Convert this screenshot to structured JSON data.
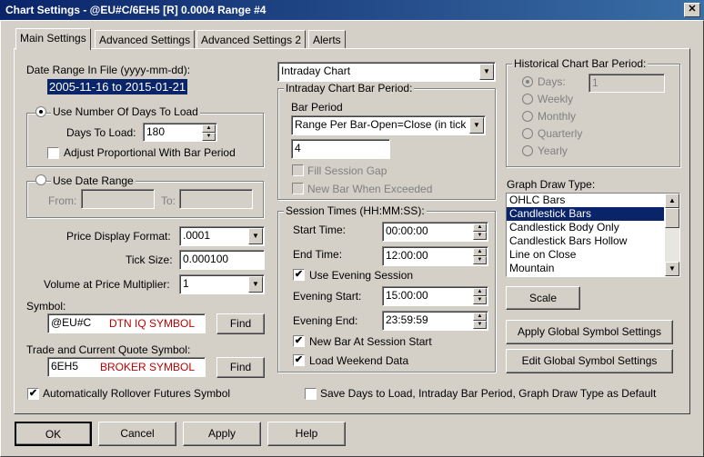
{
  "window": {
    "title": "Chart Settings - @EU#C/6EH5 [R]  0.0004 Range  #4",
    "close": "✕"
  },
  "tabs": [
    "Main Settings",
    "Advanced Settings",
    "Advanced Settings 2",
    "Alerts"
  ],
  "date_range": {
    "label": "Date Range In File (yyyy-mm-dd):",
    "value": "2005-11-16 to 2015-01-21"
  },
  "days_group": {
    "radio_label": "Use Number Of Days To Load",
    "days_label": "Days To Load:",
    "days_value": "180",
    "adjust_label": "Adjust Proportional With Bar Period"
  },
  "date_range_group": {
    "radio_label": "Use Date Range",
    "from_label": "From:",
    "to_label": "To:"
  },
  "price_format": {
    "label": "Price Display Format:",
    "value": ".0001"
  },
  "tick_size": {
    "label": "Tick Size:",
    "value": "0.000100"
  },
  "vap": {
    "label": "Volume at Price Multiplier:",
    "value": "1"
  },
  "symbol": {
    "label": "Symbol:",
    "value": "@EU#C",
    "tag": "DTN IQ SYMBOL",
    "find": "Find"
  },
  "trade_symbol": {
    "label": "Trade and Current Quote Symbol:",
    "value": "6EH5",
    "tag": "BROKER SYMBOL",
    "find": "Find"
  },
  "rollover_label": "Automatically Rollover Futures Symbol",
  "chart_type": {
    "value": "Intraday Chart"
  },
  "intraday_group": {
    "title": "Intraday Chart Bar Period:",
    "bar_period_label": "Bar Period",
    "bar_period_value": "Range Per Bar-Open=Close (in tick",
    "bar_value": "4",
    "fill_gap_label": "Fill Session Gap",
    "new_bar_label": "New Bar When Exceeded"
  },
  "session_group": {
    "title": "Session Times (HH:MM:SS):",
    "start_label": "Start Time:",
    "start_value": "00:00:00",
    "end_label": "End Time:",
    "end_value": "12:00:00",
    "evening_label": "Use Evening Session",
    "eve_start_label": "Evening Start:",
    "eve_start_value": "15:00:00",
    "eve_end_label": "Evening End:",
    "eve_end_value": "23:59:59",
    "new_bar_label": "New Bar At Session Start",
    "weekend_label": "Load Weekend Data"
  },
  "save_defaults_label": "Save Days to Load, Intraday Bar Period, Graph Draw Type as Default",
  "historical_group": {
    "title": "Historical Chart Bar Period:",
    "options": [
      "Days:",
      "Weekly",
      "Monthly",
      "Quarterly",
      "Yearly"
    ],
    "days_value": "1"
  },
  "graph_draw": {
    "label": "Graph Draw Type:",
    "items": [
      "OHLC Bars",
      "Candlestick Bars",
      "Candlestick Body Only",
      "Candlestick Bars Hollow",
      "Line on Close",
      "Mountain"
    ],
    "selected": "Candlestick Bars"
  },
  "scale_button": "Scale",
  "apply_global_button": "Apply Global Symbol Settings",
  "edit_global_button": "Edit Global Symbol Settings",
  "footer": {
    "ok": "OK",
    "cancel": "Cancel",
    "apply": "Apply",
    "help": "Help"
  },
  "check_mark": "✔"
}
